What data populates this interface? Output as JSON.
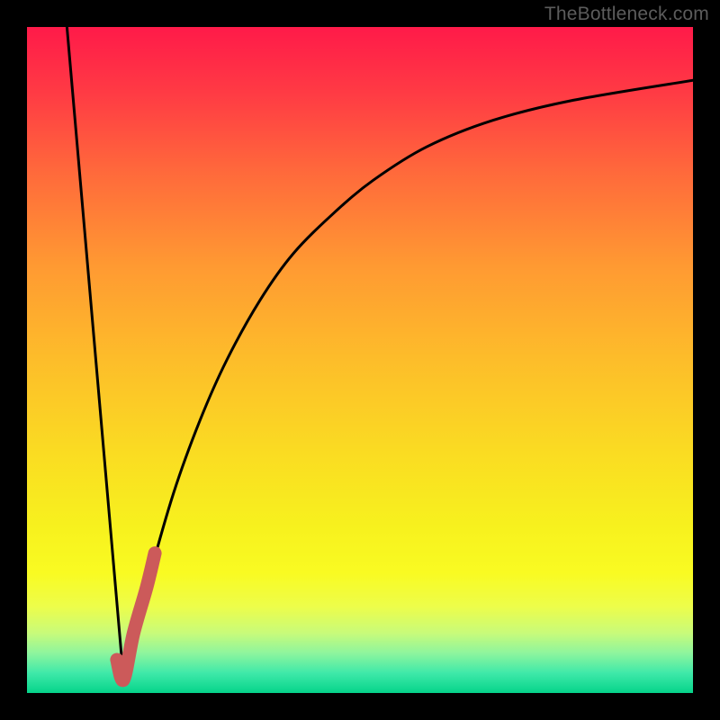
{
  "watermark": "TheBottleneck.com",
  "colors": {
    "frame": "#000000",
    "curve": "#000000",
    "marker": "#cc5a5a"
  },
  "chart_data": {
    "type": "line",
    "title": "",
    "xlabel": "",
    "ylabel": "",
    "xlim": [
      0,
      100
    ],
    "ylim": [
      0,
      100
    ],
    "grid": false,
    "legend": false,
    "series": [
      {
        "name": "falling-line",
        "x": [
          6,
          14.5
        ],
        "y": [
          100,
          2
        ]
      },
      {
        "name": "rising-curve",
        "x": [
          14.5,
          18,
          22,
          26,
          30,
          35,
          40,
          46,
          52,
          60,
          70,
          82,
          100
        ],
        "y": [
          2,
          16,
          30,
          41,
          50,
          59,
          66,
          72,
          77,
          82,
          86,
          89,
          92
        ]
      }
    ],
    "marker_segment": {
      "name": "highlight-J",
      "x": [
        13.5,
        14.5,
        16,
        18,
        19.2
      ],
      "y": [
        5,
        2,
        9,
        16,
        21
      ]
    }
  }
}
